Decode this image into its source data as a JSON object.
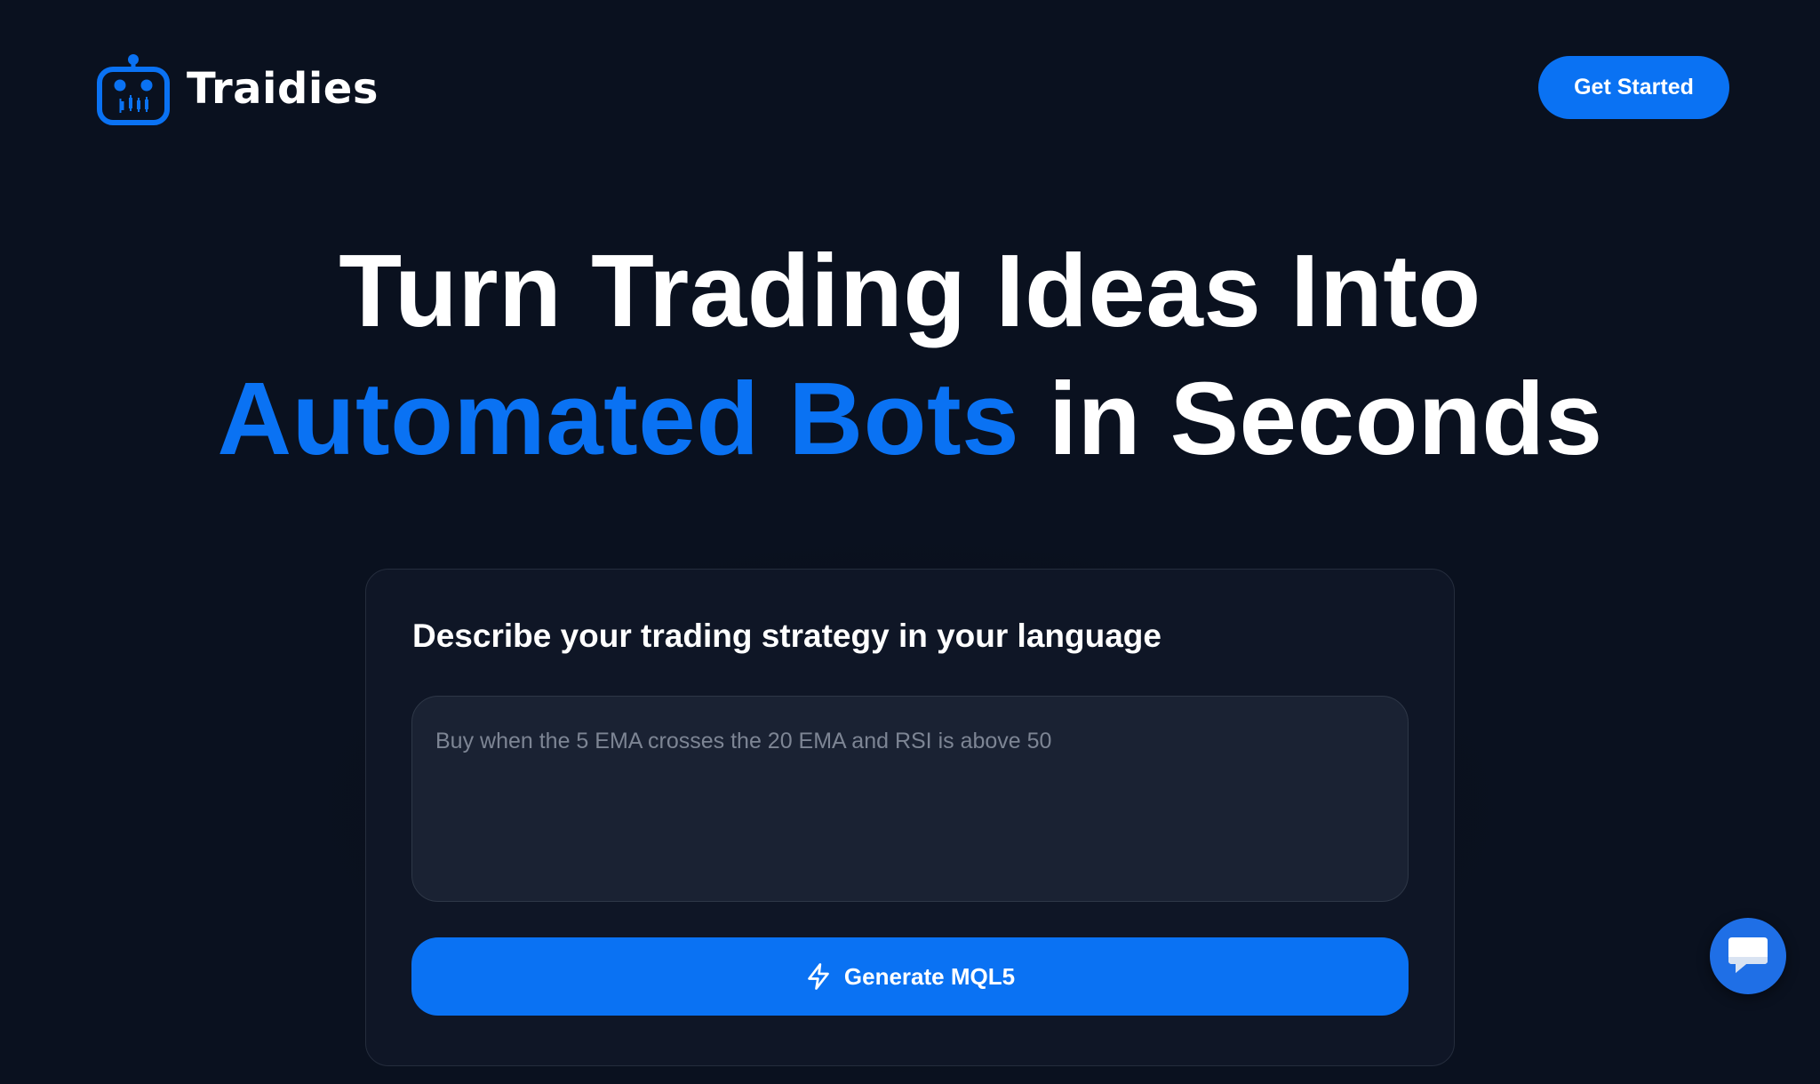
{
  "header": {
    "brand_name": "Traidies",
    "cta_label": "Get Started"
  },
  "hero": {
    "line1": "Turn Trading Ideas Into",
    "line2_accent": "Automated Bots",
    "line2_rest": " in Seconds"
  },
  "card": {
    "title": "Describe your trading strategy in your language",
    "input": {
      "placeholder": "Buy when the 5 EMA crosses the 20 EMA and RSI is above 50",
      "value": ""
    },
    "generate_label": "Generate MQL5"
  },
  "icons": {
    "logo": "robot-icon",
    "generate": "bolt-icon",
    "chat": "chat-bubble-icon"
  },
  "colors": {
    "background": "#0a111f",
    "accent": "#0a72f3",
    "card": "#0f1626",
    "input": "#1a2233"
  }
}
